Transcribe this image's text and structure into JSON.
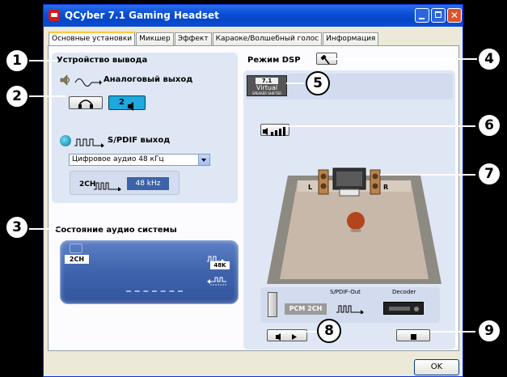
{
  "window": {
    "title": "QCyber 7.1 Gaming Headset",
    "ok_label": "OK"
  },
  "tabs": [
    {
      "label": "Основные установки"
    },
    {
      "label": "Микшер"
    },
    {
      "label": "Эффект"
    },
    {
      "label": "Караоке/Волшебный голос"
    },
    {
      "label": "Информация"
    }
  ],
  "output_device": {
    "heading": "Устройство вывода",
    "analog_label": "Аналоговый выход",
    "analog_mode_value": "2",
    "spdif_label": "S/PDIF выход",
    "spdif_select_value": "Цифровое аудио 48 кГц",
    "spdif_channels": "2CH",
    "spdif_rate": "48 kHz"
  },
  "audio_status": {
    "heading": "Состояние аудио системы",
    "channels": "2CH",
    "rate": "48K"
  },
  "dsp": {
    "heading": "Режим DSP",
    "virtual_badge_top": "7.1",
    "virtual_badge_mid": "Virtual",
    "virtual_badge_bottom": "SPEAKER SHIFTER",
    "speaker_left": "L",
    "speaker_right": "R"
  },
  "signal_chain": {
    "spdif_out_label": "S/PDIF-Out",
    "decoder_label": "Decoder",
    "pcm_label": "PCM 2CH"
  },
  "callouts": [
    "1",
    "2",
    "3",
    "4",
    "5",
    "6",
    "7",
    "8",
    "9"
  ]
}
